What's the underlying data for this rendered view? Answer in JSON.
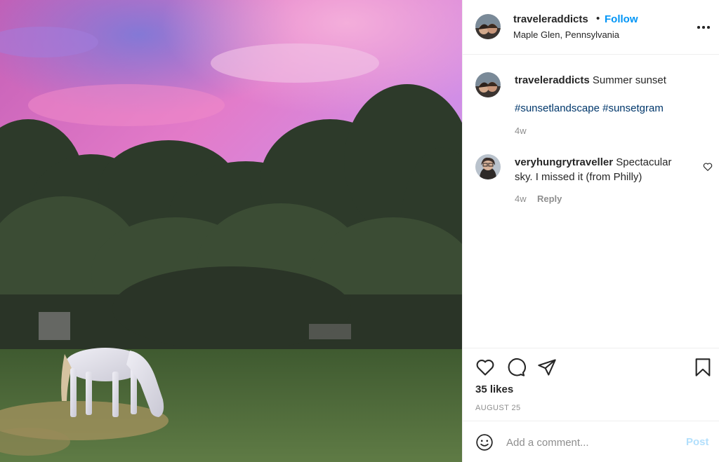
{
  "post": {
    "photo_alt": "",
    "username": "traveleraddicts",
    "separator": "•",
    "follow_label": "Follow",
    "location": "Maple Glen, Pennsylvania",
    "more_icon": "more-options-icon"
  },
  "caption": {
    "username": "traveleraddicts",
    "text": "Summer sunset",
    "hashtags": [
      "#sunsetlandscape",
      "#sunsetgram"
    ],
    "time": "4w"
  },
  "comments": [
    {
      "username": "veryhungrytraveller",
      "text": "Spectacular sky. I missed it (from Philly)",
      "time": "4w",
      "reply_label": "Reply"
    }
  ],
  "actions": {
    "likes": "35 likes",
    "date": "AUGUST 25"
  },
  "composer": {
    "placeholder": "Add a comment...",
    "post_label": "Post"
  },
  "colors": {
    "link_blue": "#0095f6",
    "hashtag_blue": "#00376b",
    "muted_gray": "#8e8e8e",
    "post_disabled": "#b2dffc"
  }
}
